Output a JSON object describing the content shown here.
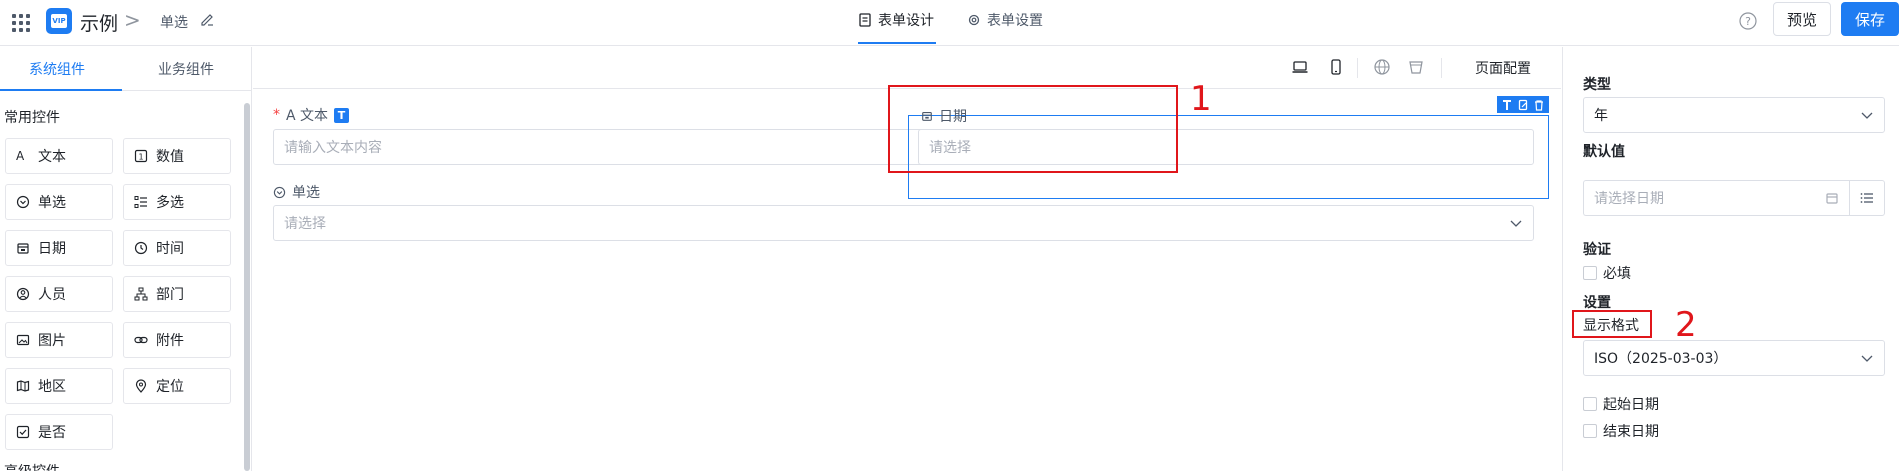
{
  "app": {
    "title": "示例",
    "logo_text": "VIP",
    "breadcrumb_sep": ">",
    "breadcrumb_item": "单选"
  },
  "top_tabs": {
    "design": "表单设计",
    "settings": "表单设置"
  },
  "actions": {
    "preview": "预览",
    "save": "保存"
  },
  "left": {
    "tab_system": "系统组件",
    "tab_business": "业务组件",
    "group_common": "常用控件",
    "group_advanced": "高级控件",
    "components": [
      {
        "label": "文本",
        "icon": "text-icon"
      },
      {
        "label": "数值",
        "icon": "number-icon"
      },
      {
        "label": "单选",
        "icon": "radio-icon"
      },
      {
        "label": "多选",
        "icon": "checklist-icon"
      },
      {
        "label": "日期",
        "icon": "calendar-icon"
      },
      {
        "label": "时间",
        "icon": "clock-icon"
      },
      {
        "label": "人员",
        "icon": "person-icon"
      },
      {
        "label": "部门",
        "icon": "org-icon"
      },
      {
        "label": "图片",
        "icon": "image-icon"
      },
      {
        "label": "附件",
        "icon": "link-icon"
      },
      {
        "label": "地区",
        "icon": "map-icon"
      },
      {
        "label": "定位",
        "icon": "location-icon"
      },
      {
        "label": "是否",
        "icon": "checkbox-icon"
      }
    ]
  },
  "canvas": {
    "page_config": "页面配置",
    "fields": {
      "text_label": "A 文本",
      "text_badge": "T",
      "text_placeholder": "请输入文本内容",
      "date_label": "日期",
      "date_placeholder": "请选择",
      "radio_label": "单选",
      "radio_placeholder": "请选择"
    }
  },
  "annotations": {
    "one": "1",
    "two": "2",
    "color": "#e0161b"
  },
  "right": {
    "type_title": "类型",
    "type_value": "年",
    "default_title": "默认值",
    "default_placeholder": "请选择日期",
    "validate_title": "验证",
    "required_label": "必填",
    "settings_title": "设置",
    "display_format_label": "显示格式",
    "display_format_value": "ISO（2025-03-03）",
    "start_date_label": "起始日期",
    "end_date_label": "结束日期"
  },
  "colors": {
    "accent": "#1e7cf2",
    "annotation": "#e0161b"
  }
}
